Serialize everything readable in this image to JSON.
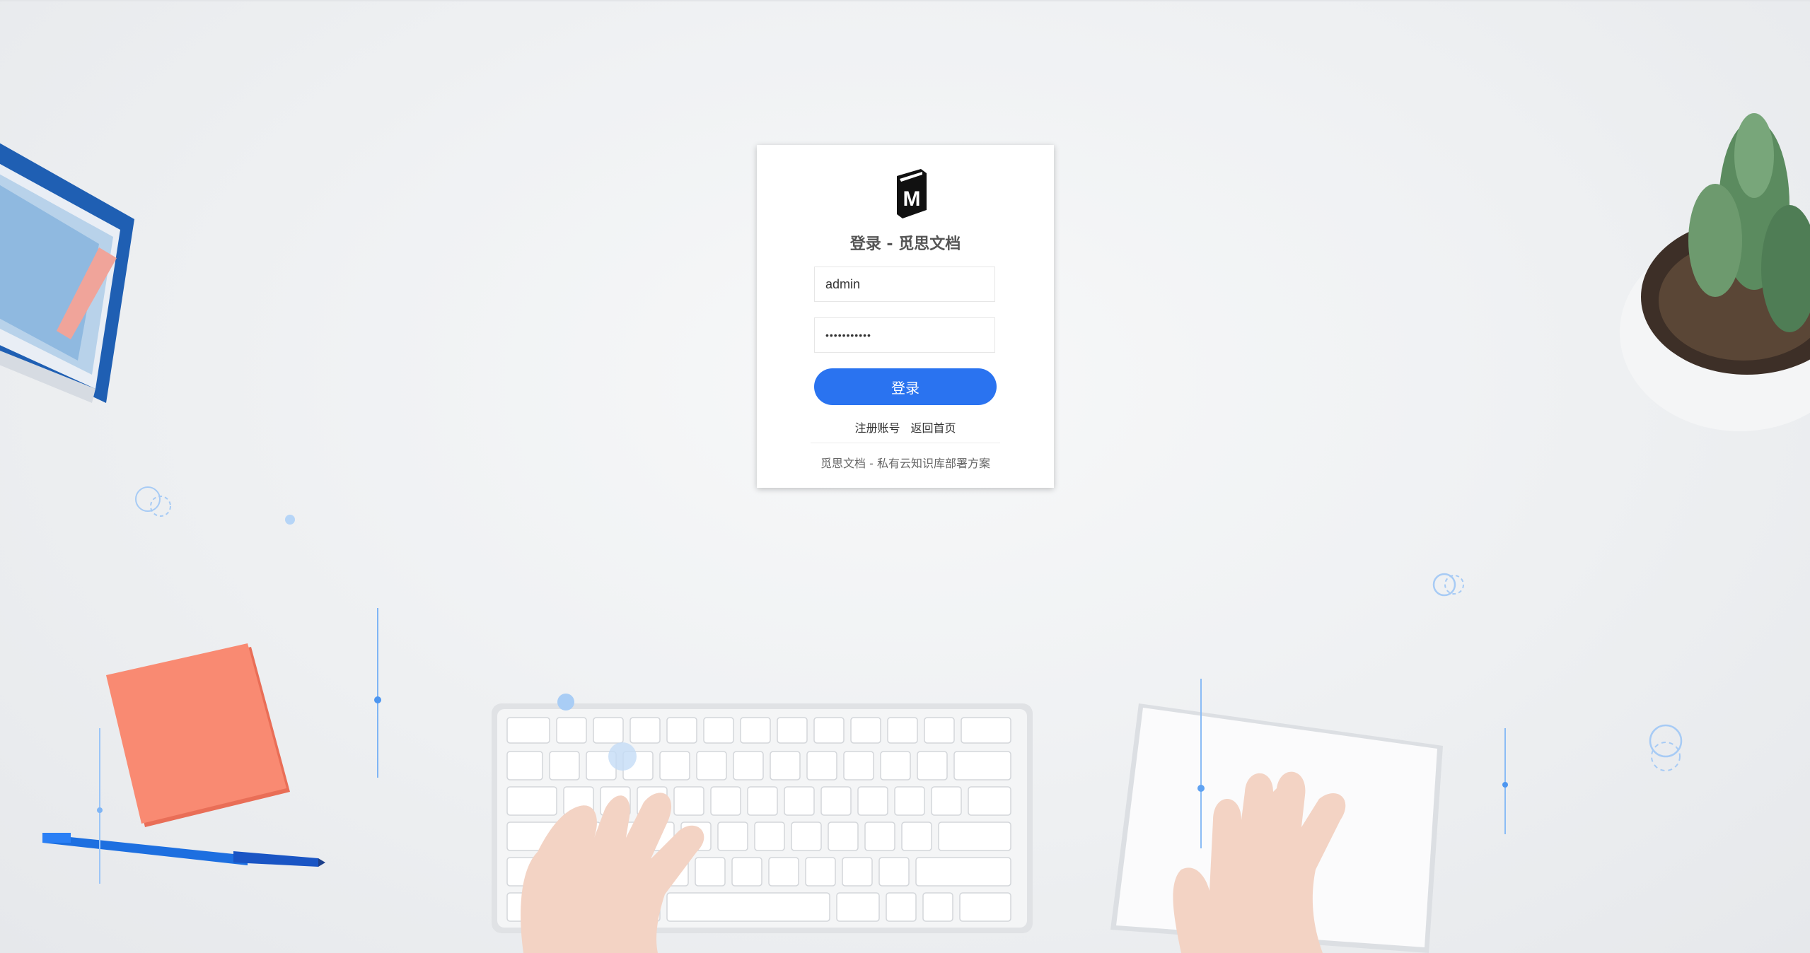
{
  "login": {
    "title": "登录 - 觅思文档",
    "logo_letter": "M",
    "username_value": "admin",
    "password_masked": "•••••••••••",
    "submit_label": "登录",
    "register_link": "注册账号",
    "home_link": "返回首页",
    "footer": "觅思文档 - 私有云知识库部署方案"
  },
  "colors": {
    "accent": "#2a73f0",
    "background": "#eef0f2"
  }
}
